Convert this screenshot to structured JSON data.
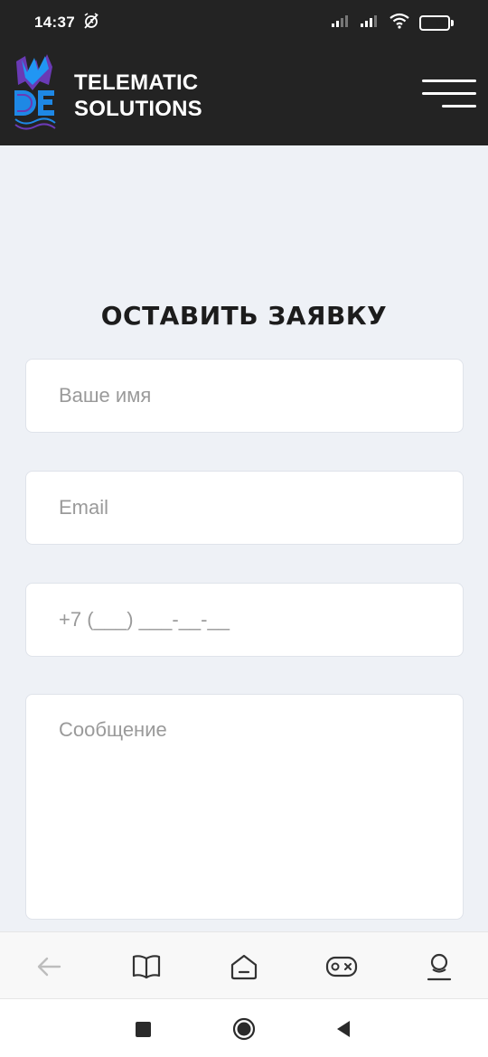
{
  "status_bar": {
    "time": "14:37",
    "battery_level": "88",
    "icons": [
      "alarm-off-icon",
      "signal-icon",
      "signal-icon",
      "wifi-icon",
      "battery-icon"
    ]
  },
  "header": {
    "brand_line1": "TELEMATIC",
    "brand_line2": "SOLUTIONS",
    "logo_icon": "telematic-logo",
    "menu_icon": "hamburger-menu-icon"
  },
  "form": {
    "title": "ОСТАВИТЬ ЗАЯВКУ",
    "name_placeholder": "Ваше имя",
    "email_placeholder": "Email",
    "phone_placeholder": "+7 (___) ___-__-__",
    "message_placeholder": "Сообщение"
  },
  "bottom_nav": {
    "items": [
      "back-arrow-icon",
      "book-icon",
      "home-icon",
      "gamepad-icon",
      "profile-icon"
    ]
  },
  "system_nav": {
    "items": [
      "recents-square-icon",
      "home-circle-icon",
      "back-triangle-icon"
    ]
  },
  "colors": {
    "header_bg": "#232323",
    "page_bg": "#eef1f6",
    "logo_blue": "#1e88e5",
    "logo_purple": "#6a3ab5"
  }
}
